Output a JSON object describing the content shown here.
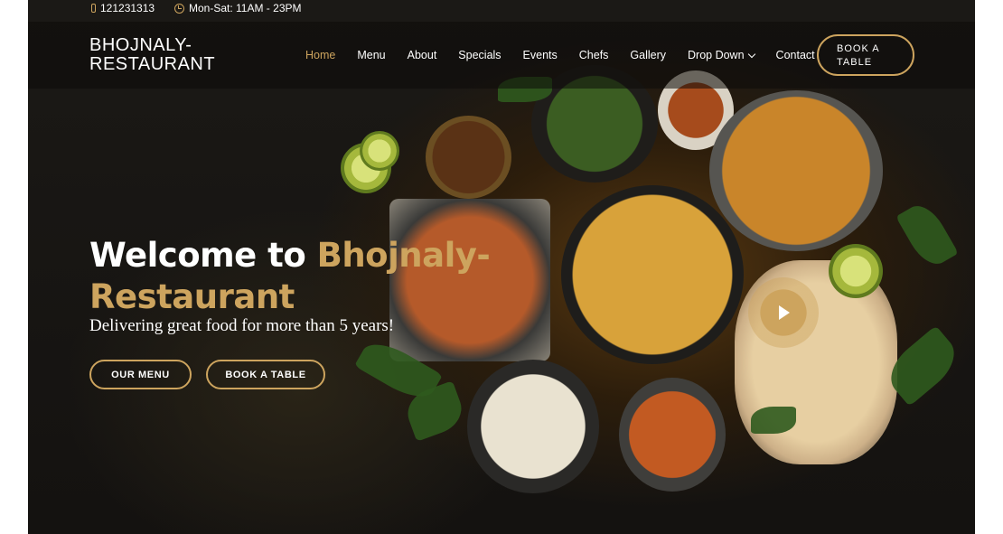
{
  "topbar": {
    "phone": "121231313",
    "hours": "Mon-Sat: 11AM - 23PM",
    "phone_icon": "phone-icon",
    "clock_icon": "clock-icon"
  },
  "brand": {
    "line1": "BHOJNALY-",
    "line2": "RESTAURANT"
  },
  "nav": {
    "items": [
      "Home",
      "Menu",
      "About",
      "Specials",
      "Events",
      "Chefs",
      "Gallery",
      "Drop Down",
      "Contact"
    ],
    "active": "Home",
    "book_label_line1": "BOOK A",
    "book_label_line2": "TABLE"
  },
  "hero": {
    "title_white": "Welcome to ",
    "title_accent": "Bhojnaly-Restaurant",
    "subtitle": "Delivering great food for more than 5 years!",
    "menu_button": "OUR MENU",
    "book_button": "BOOK A TABLE",
    "play_icon": "play-icon"
  },
  "colors": {
    "accent": "#cda45e",
    "header_bg": "#0c0b09",
    "text": "#ffffff"
  }
}
